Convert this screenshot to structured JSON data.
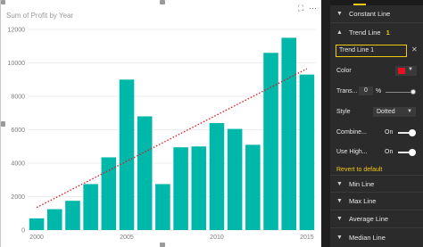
{
  "chart_data": {
    "type": "bar",
    "title": "Sum of Profit by Year",
    "categories": [
      2000,
      2001,
      2002,
      2003,
      2004,
      2005,
      2006,
      2007,
      2008,
      2009,
      2010,
      2011,
      2012,
      2013,
      2014,
      2015
    ],
    "values": [
      700,
      1250,
      1750,
      2750,
      4350,
      9000,
      6800,
      2750,
      4950,
      5000,
      6400,
      6050,
      5100,
      10600,
      11500,
      9300
    ],
    "x_tick_labels": [
      "2000",
      "2005",
      "2010",
      "2015"
    ],
    "y_ticks": [
      0,
      2000,
      4000,
      6000,
      8000,
      10000,
      12000
    ],
    "y_tick_labels": [
      "0",
      "2000",
      "4000",
      "6000",
      "8000",
      "10000",
      "12000"
    ],
    "ylim": [
      0,
      12000
    ],
    "bar_color": "#00b8aa",
    "trend_line": {
      "start": 1350,
      "end": 9650,
      "color": "#e81123",
      "style": "Dotted"
    },
    "grid": true
  },
  "visual": {
    "focus_icon": "focus-mode-icon",
    "more_icon": "more-options-icon"
  },
  "pane": {
    "constant_line_label": "Constant Line",
    "trend_line_label": "Trend Line",
    "trend_line_count": "1",
    "trend_name_value": "Trend Line 1",
    "color_label": "Color",
    "color_value": "#e81123",
    "transparency_label": "Trans...",
    "transparency_value": "0",
    "transparency_unit": "%",
    "style_label": "Style",
    "style_value": "Dotted",
    "combine_label": "Combine...",
    "combine_value": "On",
    "use_high_label": "Use High...",
    "use_high_value": "On",
    "revert_label": "Revert to default",
    "min_line_label": "Min Line",
    "max_line_label": "Max Line",
    "average_line_label": "Average Line",
    "median_line_label": "Median Line"
  }
}
